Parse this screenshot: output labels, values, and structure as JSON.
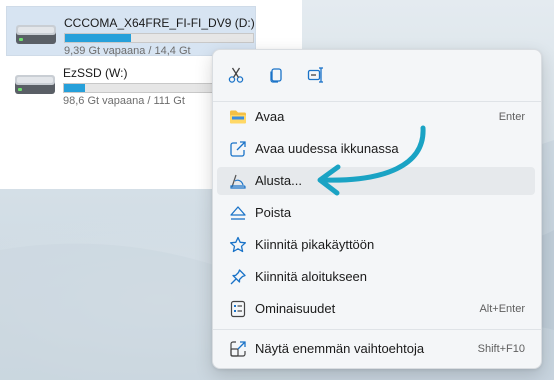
{
  "drives": [
    {
      "name": "CCCOMA_X64FRE_FI-FI_DV9 (D:)",
      "free_text": "9,39 Gt vapaana / 14,4 Gt",
      "used_fraction": 0.35,
      "selected": true
    },
    {
      "name": "EzSSD (W:)",
      "free_text": "98,6 Gt vapaana / 111 Gt",
      "used_fraction": 0.11,
      "selected": false
    }
  ],
  "context_menu": {
    "quick_actions": [
      {
        "icon": "cut-icon"
      },
      {
        "icon": "copy-icon"
      },
      {
        "icon": "rename-icon"
      }
    ],
    "items": [
      {
        "label": "Avaa",
        "shortcut": "Enter",
        "icon": "folder-icon"
      },
      {
        "label": "Avaa uudessa ikkunassa",
        "shortcut": "",
        "icon": "open-new-window-icon"
      },
      {
        "label": "Alusta...",
        "shortcut": "",
        "icon": "format-icon",
        "highlighted": true
      },
      {
        "label": "Poista",
        "shortcut": "",
        "icon": "eject-icon"
      },
      {
        "label": "Kiinnitä pikakäyttöön",
        "shortcut": "",
        "icon": "star-icon"
      },
      {
        "label": "Kiinnitä aloitukseen",
        "shortcut": "",
        "icon": "pin-icon"
      },
      {
        "label": "Ominaisuudet",
        "shortcut": "Alt+Enter",
        "icon": "properties-icon"
      },
      {
        "label": "Näytä enemmän vaihtoehtoja",
        "shortcut": "Shift+F10",
        "icon": "more-options-icon"
      }
    ]
  },
  "colors": {
    "accent": "#1a73c8",
    "progress": "#26a0da",
    "annotation_arrow": "#1aa3c4",
    "selection": "#d7e4f2"
  }
}
